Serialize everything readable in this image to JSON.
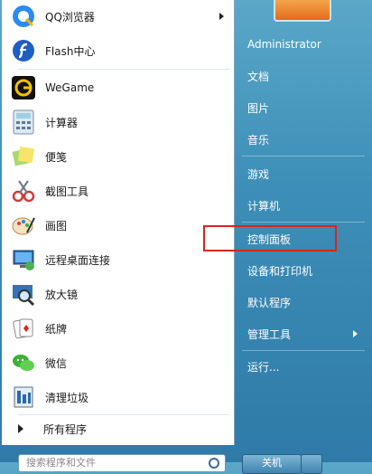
{
  "left_items": [
    {
      "label": "QQ浏览器",
      "icon": "qq-browser-icon",
      "has_submenu": true
    },
    {
      "label": "Flash中心",
      "icon": "flash-icon",
      "has_submenu": false
    },
    {
      "label": "WeGame",
      "icon": "wegame-icon",
      "has_submenu": false
    },
    {
      "label": "计算器",
      "icon": "calculator-icon",
      "has_submenu": false
    },
    {
      "label": "便笺",
      "icon": "sticky-notes-icon",
      "has_submenu": false
    },
    {
      "label": "截图工具",
      "icon": "snipping-tool-icon",
      "has_submenu": false
    },
    {
      "label": "画图",
      "icon": "paint-icon",
      "has_submenu": false
    },
    {
      "label": "远程桌面连接",
      "icon": "remote-desktop-icon",
      "has_submenu": false
    },
    {
      "label": "放大镜",
      "icon": "magnifier-icon",
      "has_submenu": false
    },
    {
      "label": "纸牌",
      "icon": "solitaire-icon",
      "has_submenu": false
    },
    {
      "label": "微信",
      "icon": "wechat-icon",
      "has_submenu": false
    },
    {
      "label": "清理垃圾",
      "icon": "cleanup-icon",
      "has_submenu": false
    }
  ],
  "all_programs": "所有程序",
  "search": {
    "placeholder": "搜索程序和文件"
  },
  "right_items": [
    {
      "label": "Administrator",
      "has_submenu": false
    },
    {
      "label": "文档",
      "has_submenu": false
    },
    {
      "label": "图片",
      "has_submenu": false
    },
    {
      "label": "音乐",
      "has_submenu": false
    },
    {
      "label": "游戏",
      "has_submenu": false
    },
    {
      "label": "计算机",
      "has_submenu": false
    },
    {
      "label": "控制面板",
      "has_submenu": false
    },
    {
      "label": "设备和打印机",
      "has_submenu": false
    },
    {
      "label": "默认程序",
      "has_submenu": false
    },
    {
      "label": "管理工具",
      "has_submenu": true
    },
    {
      "label": "运行...",
      "has_submenu": false
    }
  ],
  "shutdown_label": "关机",
  "colors": {
    "highlight_border": "#d9251d",
    "pane_right": "#3d8fb8"
  }
}
